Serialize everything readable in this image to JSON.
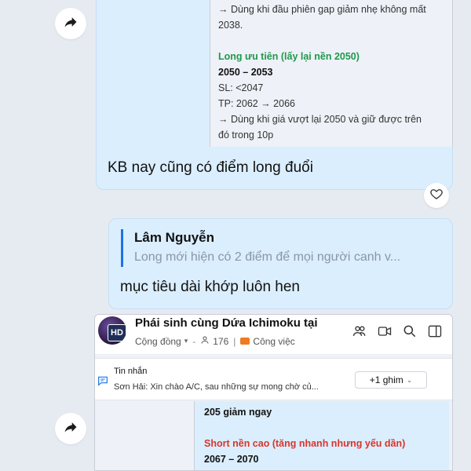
{
  "top_screenshot": {
    "lines": [
      {
        "text": "→ Dùng khi đầu phiên gap giảm nhẹ không mất",
        "style": "normal"
      },
      {
        "text": "2038.",
        "style": "normal"
      },
      {
        "text": "",
        "style": "gap"
      },
      {
        "text": "Long ưu tiên (lấy lại nền 2050)",
        "style": "green"
      },
      {
        "text": "2050 – 2053",
        "style": "bold"
      },
      {
        "text": "SL: <2047",
        "style": "normal"
      },
      {
        "text": "TP: 2062 → 2066",
        "style": "normal"
      },
      {
        "text": "→ Dùng khi giá vượt lại 2050 và giữ được trên",
        "style": "normal"
      },
      {
        "text": "đó trong 10p",
        "style": "normal"
      }
    ]
  },
  "message_1": {
    "text": "KB nay cũng có điểm long đuổi"
  },
  "reply": {
    "quote_author": "Lâm Nguyễn",
    "quote_text": "Long mới hiện có 2 điểm để mọi người canh v...",
    "text": "mục tiêu dài khớp luôn hen"
  },
  "phone": {
    "avatar_badge": "HD",
    "group_title": "Phái sinh cùng Dứa Ichimoku tại",
    "community": "Cộng đồng",
    "members": "176",
    "tag": "Công việc",
    "pinned_label": "Tin nhắn",
    "pinned_message": "Sơn Hải: Xin chào A/C, sau những sự mong chờ củ...",
    "pin_button": "+1 ghim",
    "inner_lines": [
      {
        "text": "205 giảm ngay",
        "style": "bold"
      },
      {
        "text": "",
        "style": "gap"
      },
      {
        "text": "Short nền cao (tăng nhanh nhưng yếu dần)",
        "style": "red"
      },
      {
        "text": "2067 – 2070",
        "style": "bold"
      }
    ]
  },
  "colors": {
    "accent": "#1a73e8",
    "bubble": "#dbeefe",
    "green": "#1d9a4c",
    "red": "#d9352b"
  }
}
